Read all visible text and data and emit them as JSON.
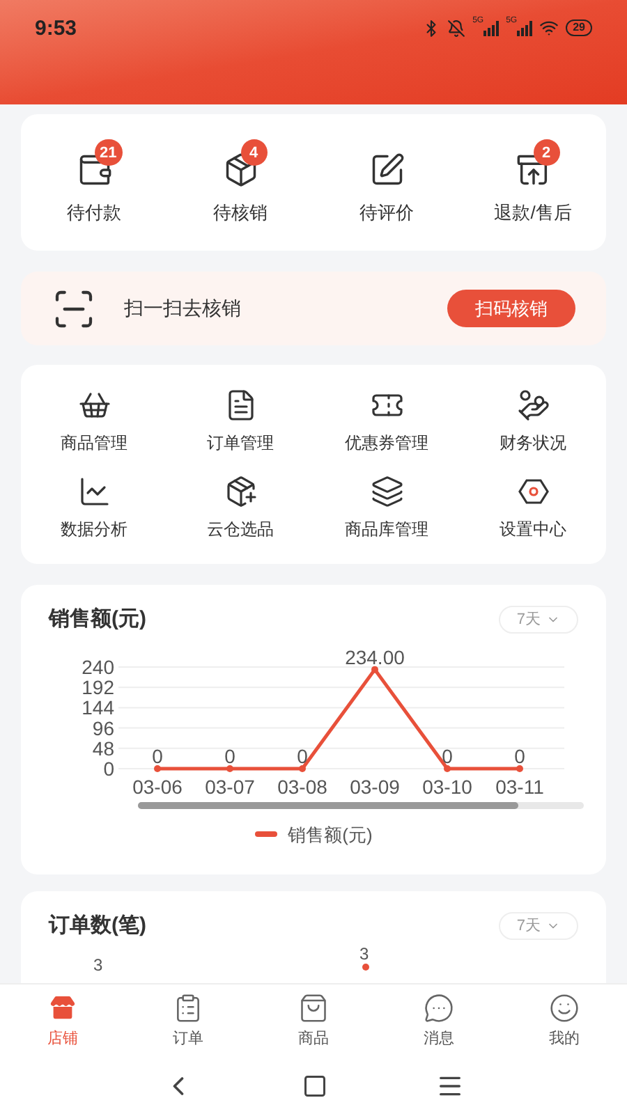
{
  "status_bar": {
    "time": "9:53",
    "network_labels": [
      "5G",
      "5G"
    ],
    "battery": "29"
  },
  "order_status": [
    {
      "label": "待付款",
      "badge": "21"
    },
    {
      "label": "待核销",
      "badge": "4"
    },
    {
      "label": "待评价"
    },
    {
      "label": "退款/售后",
      "badge": "2"
    }
  ],
  "scan_banner": {
    "text": "扫一扫去核销",
    "button": "扫码核销"
  },
  "tools": [
    "商品管理",
    "订单管理",
    "优惠券管理",
    "财务状况",
    "数据分析",
    "云仓选品",
    "商品库管理",
    "设置中心"
  ],
  "sales_card": {
    "title": "销售额(元)",
    "period": "7天",
    "chart_data": {
      "type": "line",
      "categories": [
        "03-06",
        "03-07",
        "03-08",
        "03-09",
        "03-10",
        "03-11"
      ],
      "series": [
        {
          "name": "销售额(元)",
          "color": "#e8503a",
          "values": [
            0,
            0,
            0,
            234,
            0,
            0
          ]
        }
      ],
      "grid": true,
      "marker": true,
      "ylim": [
        0,
        240
      ],
      "yticks": [
        0,
        48,
        96,
        144,
        192,
        240
      ],
      "value_labels": [
        "0",
        "0",
        "0",
        "234.00",
        "0",
        "0"
      ]
    }
  },
  "orders_card": {
    "title": "订单数(笔)",
    "period": "7天",
    "ytick_label": "3",
    "point_label": "3"
  },
  "tab_bar": [
    {
      "label": "店铺",
      "selected": true
    },
    {
      "label": "订单",
      "selected": false
    },
    {
      "label": "商品",
      "selected": false
    },
    {
      "label": "消息",
      "selected": false
    },
    {
      "label": "我的",
      "selected": false
    }
  ]
}
